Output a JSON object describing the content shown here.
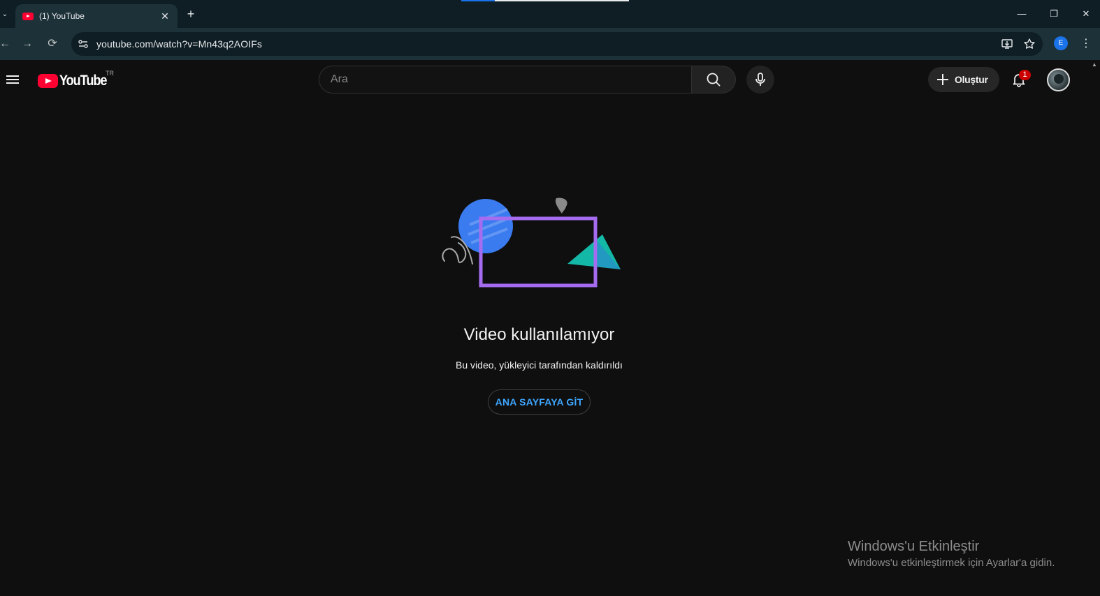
{
  "browser": {
    "tab_title": "(1) YouTube",
    "url": "youtube.com/watch?v=Mn43q2AOIFs",
    "profile_initial": "E"
  },
  "youtube": {
    "logo_text": "YouTube",
    "country_code": "TR",
    "search_placeholder": "Ara",
    "create_label": "Oluştur",
    "notification_count": "1"
  },
  "error": {
    "title": "Video kullanılamıyor",
    "message": "Bu video, yükleyici tarafından kaldırıldı",
    "home_button": "ANA SAYFAYA GİT"
  },
  "watermark": {
    "title": "Windows'u Etkinleştir",
    "subtitle": "Windows'u etkinleştirmek için Ayarlar'a gidin."
  },
  "colors": {
    "background": "#0f0f0f",
    "brand_red": "#ff0033",
    "link_blue": "#3ea6ff",
    "illus_blue": "#3a7bf0",
    "illus_purple": "#a56cf0",
    "illus_teal": "#14b8a6"
  }
}
